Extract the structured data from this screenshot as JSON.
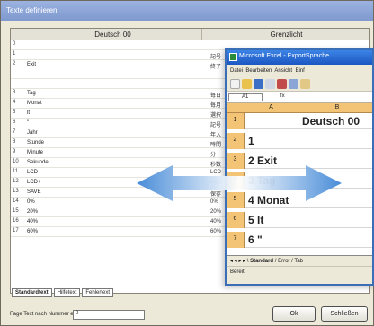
{
  "dialog": {
    "title": "Texte definieren",
    "columns": [
      "Deutsch 00",
      "Grenzlicht"
    ],
    "rows": [
      {
        "n": "0",
        "t": "",
        "t2": ""
      },
      {
        "n": "1",
        "t": "",
        "t2": "記号"
      },
      {
        "n": "2",
        "t": "Exit",
        "t2": "終了"
      },
      {
        "n": "",
        "t": "",
        "t2": ""
      },
      {
        "n": "3",
        "t": "Tag",
        "t2": "毎日"
      },
      {
        "n": "4",
        "t": "Monat",
        "t2": "毎月"
      },
      {
        "n": "5",
        "t": "lt",
        "t2": "選択"
      },
      {
        "n": "6",
        "t": "\"",
        "t2": "記号"
      },
      {
        "n": "7",
        "t": "Jahr",
        "t2": "年入"
      },
      {
        "n": "8",
        "t": "Stunde",
        "t2": "時間"
      },
      {
        "n": "9",
        "t": "Minute",
        "t2": "分"
      },
      {
        "n": "10",
        "t": "Sekunde",
        "t2": "秒数"
      },
      {
        "n": "11",
        "t": "LCD-",
        "t2": "LCD"
      },
      {
        "n": "12",
        "t": "LCD+",
        "t2": "LCD"
      },
      {
        "n": "13",
        "t": "SAVE",
        "t2": "保存"
      },
      {
        "n": "14",
        "t": "0%",
        "t2": "0%"
      },
      {
        "n": "15",
        "t": "20%",
        "t2": "20%"
      },
      {
        "n": "16",
        "t": "40%",
        "t2": "40%"
      },
      {
        "n": "17",
        "t": "60%",
        "t2": "60%"
      }
    ],
    "sheet_tabs": [
      "Standardtext",
      "Hilfetext",
      "Fehlertext"
    ],
    "search_label": "Fage Text nach Nummer ein:",
    "search_value": "0",
    "ok_label": "Ok",
    "close_label": "Schließen"
  },
  "excel": {
    "title": "Microsoft Excel - ExportSprache",
    "menu": [
      "Datei",
      "Bearbeiten",
      "Ansicht",
      "Einf"
    ],
    "cell_ref": "A1",
    "columns": [
      "A",
      "B"
    ],
    "rows": [
      {
        "n": "1",
        "a": "",
        "b": "Deutsch 00"
      },
      {
        "n": "2",
        "a": "1",
        "b": ""
      },
      {
        "n": "3",
        "a": "2 Exit",
        "b": ""
      },
      {
        "n": "4",
        "a": "3 Tag",
        "b": ""
      },
      {
        "n": "5",
        "a": "4 Monat",
        "b": ""
      },
      {
        "n": "6",
        "a": "5 lt",
        "b": ""
      },
      {
        "n": "7",
        "a": "6 \"",
        "b": ""
      }
    ],
    "sheet_tabs": [
      "Standard",
      "Error",
      "Tab"
    ],
    "status": "Bereit"
  },
  "colors": {
    "accent": "#1c57c2",
    "arrow": "#4a8fd8"
  }
}
